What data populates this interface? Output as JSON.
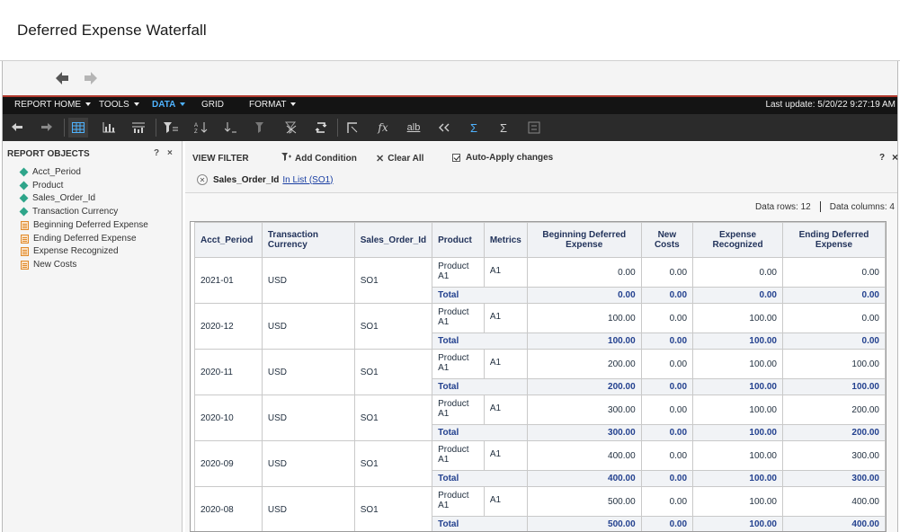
{
  "page": {
    "title": "Deferred Expense Waterfall"
  },
  "menubar": {
    "items": [
      {
        "label": "REPORT HOME",
        "caret": true
      },
      {
        "label": "TOOLS",
        "caret": true
      },
      {
        "label": "DATA",
        "caret": true,
        "active": true
      },
      {
        "label": "GRID",
        "caret": false
      },
      {
        "label": "FORMAT",
        "caret": true
      }
    ],
    "last_update": "Last update: 5/20/22 9:27:19 AM"
  },
  "toolbar": {
    "icons": [
      "undo-icon",
      "redo-icon",
      "grid-view-icon",
      "graph-view-icon",
      "grid-graph-icon",
      "filter-icon",
      "sort-ascending-icon",
      "drill-icon",
      "clear-filter-icon",
      "remove-filter-icon",
      "pivot-icon",
      "swap-icon",
      "function-icon",
      "rename-icon",
      "move-left-icon",
      "subtotals-icon",
      "sum-icon",
      "lock-icon"
    ]
  },
  "report_objects": {
    "title": "REPORT OBJECTS",
    "help": "?",
    "close": "×",
    "attributes": [
      "Acct_Period",
      "Product",
      "Sales_Order_Id",
      "Transaction Currency"
    ],
    "metrics": [
      "Beginning Deferred Expense",
      "Ending Deferred Expense",
      "Expense Recognized",
      "New Costs"
    ]
  },
  "view_filter": {
    "title": "VIEW FILTER",
    "add_condition": "Add Condition",
    "clear_all": "Clear All",
    "auto_apply": "Auto-Apply changes",
    "help": "?",
    "close": "×",
    "condition_field": "Sales_Order_Id",
    "condition_value": "In List (SO1)"
  },
  "stats": {
    "rows": "Data rows: 12",
    "columns": "Data columns: 4"
  },
  "grid": {
    "headers": [
      "Acct_Period",
      "Transaction Currency",
      "Sales_Order_Id",
      "Product",
      "Metrics",
      "Beginning Deferred Expense",
      "New Costs",
      "Expense Recognized",
      "Ending Deferred Expense"
    ],
    "total_label": "Total",
    "groups": [
      {
        "period": "2021-01",
        "currency": "USD",
        "order": "SO1",
        "product": "Product A1",
        "metric": "A1",
        "values": [
          "0.00",
          "0.00",
          "0.00",
          "0.00"
        ],
        "totals": [
          "0.00",
          "0.00",
          "0.00",
          "0.00"
        ]
      },
      {
        "period": "2020-12",
        "currency": "USD",
        "order": "SO1",
        "product": "Product A1",
        "metric": "A1",
        "values": [
          "100.00",
          "0.00",
          "100.00",
          "0.00"
        ],
        "totals": [
          "100.00",
          "0.00",
          "100.00",
          "0.00"
        ]
      },
      {
        "period": "2020-11",
        "currency": "USD",
        "order": "SO1",
        "product": "Product A1",
        "metric": "A1",
        "values": [
          "200.00",
          "0.00",
          "100.00",
          "100.00"
        ],
        "totals": [
          "200.00",
          "0.00",
          "100.00",
          "100.00"
        ]
      },
      {
        "period": "2020-10",
        "currency": "USD",
        "order": "SO1",
        "product": "Product A1",
        "metric": "A1",
        "values": [
          "300.00",
          "0.00",
          "100.00",
          "200.00"
        ],
        "totals": [
          "300.00",
          "0.00",
          "100.00",
          "200.00"
        ]
      },
      {
        "period": "2020-09",
        "currency": "USD",
        "order": "SO1",
        "product": "Product A1",
        "metric": "A1",
        "values": [
          "400.00",
          "0.00",
          "100.00",
          "300.00"
        ],
        "totals": [
          "400.00",
          "0.00",
          "100.00",
          "300.00"
        ]
      },
      {
        "period": "2020-08",
        "currency": "USD",
        "order": "SO1",
        "product": "Product A1",
        "metric": "A1",
        "values": [
          "500.00",
          "0.00",
          "100.00",
          "400.00"
        ],
        "totals": [
          "500.00",
          "0.00",
          "100.00",
          "400.00"
        ]
      }
    ]
  },
  "colors": {
    "accent": "#4fb3ff",
    "menubar_bg": "#141414",
    "menu_border": "#b23a2f",
    "total_text": "#23418f",
    "attribute_icon": "#2ea58a",
    "metric_icon": "#e08a2b"
  }
}
